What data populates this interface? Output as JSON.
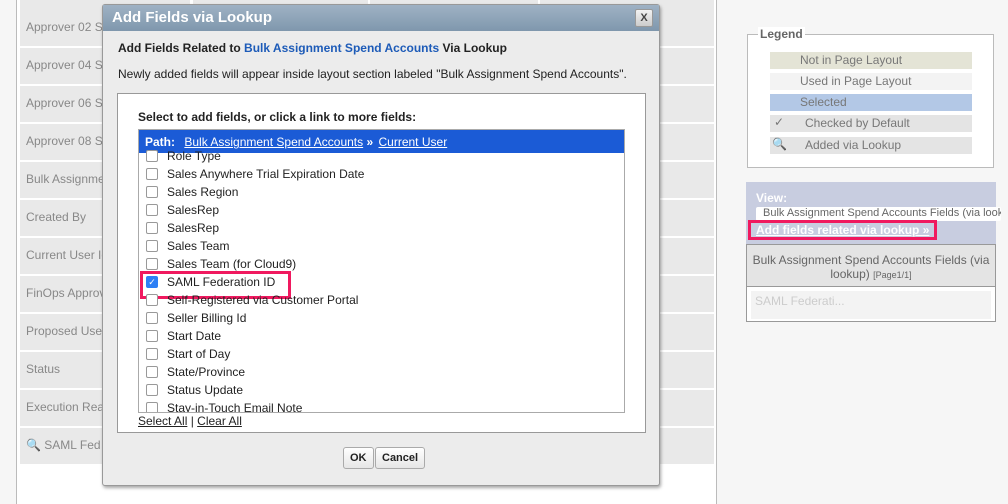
{
  "background_rows": [
    "Approver 02 S",
    "Approver 04 S",
    "Approver 06 S",
    "Approver 08 S",
    "Bulk Assignme",
    "Created By",
    "Current User Id",
    "FinOps Approv",
    "Proposed User",
    "Status",
    "Execution Rea",
    "SAML Fed"
  ],
  "dialog": {
    "title": "Add Fields via Lookup",
    "close_label": "X",
    "header_prefix": "Add Fields Related to",
    "header_object": "Bulk Assignment Spend Accounts",
    "header_suffix": "Via Lookup",
    "note": "Newly added fields will appear inside layout section labeled \"Bulk Assignment Spend Accounts\".",
    "select_prompt": "Select to add fields, or click a link to more fields:",
    "path_label": "Path:",
    "path_links": [
      "Bulk Assignment Spend Accounts",
      "Current User"
    ],
    "path_separator": "»",
    "fields": [
      {
        "label": "Role Type",
        "checked": false
      },
      {
        "label": "Sales Anywhere Trial Expiration Date",
        "checked": false
      },
      {
        "label": "Sales Region",
        "checked": false
      },
      {
        "label": "SalesRep",
        "checked": false
      },
      {
        "label": "SalesRep",
        "checked": false
      },
      {
        "label": "Sales Team",
        "checked": false
      },
      {
        "label": "Sales Team (for Cloud9)",
        "checked": false
      },
      {
        "label": "SAML Federation ID",
        "checked": true
      },
      {
        "label": "Self-Registered via Customer Portal",
        "checked": false
      },
      {
        "label": "Seller Billing Id",
        "checked": false
      },
      {
        "label": "Start Date",
        "checked": false
      },
      {
        "label": "Start of Day",
        "checked": false
      },
      {
        "label": "State/Province",
        "checked": false
      },
      {
        "label": "Status Update",
        "checked": false
      },
      {
        "label": "Stay-in-Touch Email Note",
        "checked": false
      }
    ],
    "select_all": "Select All",
    "clear_all": "Clear All",
    "link_sep": "|",
    "ok": "OK",
    "cancel": "Cancel"
  },
  "legend": {
    "title": "Legend",
    "items": [
      {
        "label": "Not in Page Layout",
        "color": "#e4e4d6"
      },
      {
        "label": "Used in Page Layout",
        "color": "#f3f3f3"
      },
      {
        "label": "Selected",
        "color": "#b3c8e6"
      },
      {
        "label": "Checked by Default",
        "icon": "checkmark-icon",
        "color": "#e4e4e4"
      },
      {
        "label": "Added via Lookup",
        "icon": "magnifier-icon",
        "color": "#e4e4e4"
      }
    ]
  },
  "view": {
    "label": "View:",
    "selected": "Bulk Assignment Spend Accounts Fields (via lookup)",
    "add_link": "Add fields related via lookup »"
  },
  "palette": {
    "header": "Bulk Assignment Spend Accounts Fields (via lookup)",
    "page": "[Page1/1]",
    "field": "SAML Federati..."
  },
  "colors": {
    "highlight": "#f0195f",
    "path_bar": "#1b5bd6",
    "link": "#1d5bb8"
  }
}
